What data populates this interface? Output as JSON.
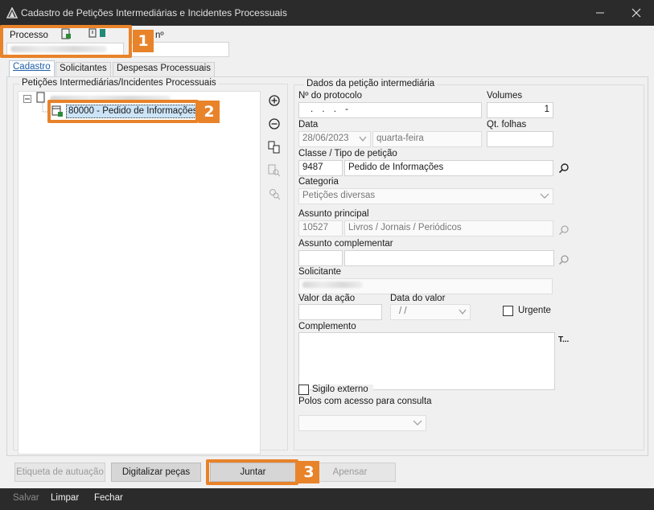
{
  "window": {
    "title": "Cadastro de Petições Intermediárias e Incidentes Processuais"
  },
  "header": {
    "processo_label": "Processo",
    "numero_label": "nº"
  },
  "tabs": [
    {
      "label": "Cadastro",
      "active": true
    },
    {
      "label": "Solicitantes",
      "active": false
    },
    {
      "label": "Despesas Processuais",
      "active": false
    }
  ],
  "tree": {
    "group_label": "Petições Intermediárias/Incidentes Processuais",
    "selected_item": "80000 - Pedido de Informações"
  },
  "form": {
    "group_label": "Dados da petição intermediária",
    "protocolo_label": "Nº do protocolo",
    "protocolo_value": ". . . -",
    "volumes_label": "Volumes",
    "volumes_value": "1",
    "data_label": "Data",
    "data_value": "28/06/2023",
    "weekday_value": "quarta-feira",
    "qt_folhas_label": "Qt. folhas",
    "classe_label": "Classe / Tipo de petição",
    "classe_code": "9487",
    "classe_name": "Pedido de Informações",
    "categoria_label": "Categoria",
    "categoria_value": "Petições diversas",
    "assunto_principal_label": "Assunto principal",
    "assunto_principal_code": "10527",
    "assunto_principal_name": "Livros / Jornais / Periódicos",
    "assunto_complementar_label": "Assunto complementar",
    "solicitante_label": "Solicitante",
    "valor_acao_label": "Valor da ação",
    "data_valor_label": "Data do valor",
    "data_valor_value": "/ /",
    "urgente_label": "Urgente",
    "complemento_label": "Complemento",
    "complemento_more": "T...",
    "sigilo_label": "Sigilo externo",
    "polos_label": "Polos com acesso para consulta"
  },
  "buttons": {
    "etiqueta": "Etiqueta de autuação",
    "digitalizar": "Digitalizar peças",
    "juntar": "Juntar",
    "apensar": "Apensar"
  },
  "footer": {
    "salvar": "Salvar",
    "limpar": "Limpar",
    "fechar": "Fechar"
  },
  "annotations": {
    "step1": "1",
    "step2": "2",
    "step3": "3"
  },
  "colors": {
    "highlight": "#e8832a",
    "titlebar": "#2b2b2b",
    "selection": "#cce4f7"
  }
}
